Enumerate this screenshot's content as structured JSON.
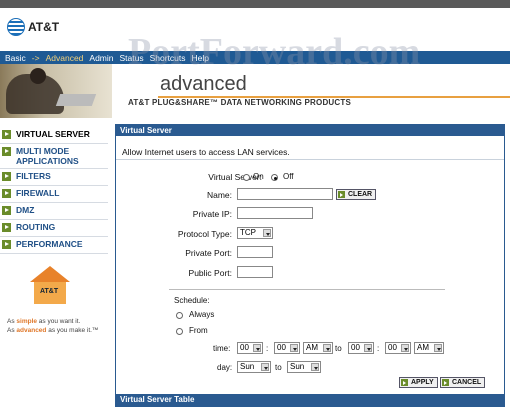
{
  "header": {
    "logo_text": "AT&T",
    "watermark": "PortForward.com"
  },
  "nav": {
    "items": [
      {
        "label": "Basic"
      },
      {
        "label": "->"
      },
      {
        "label": "Advanced"
      },
      {
        "label": "Admin"
      },
      {
        "label": "Status"
      },
      {
        "label": "Shortcuts"
      },
      {
        "label": "Help"
      }
    ]
  },
  "banner": {
    "title": "advanced",
    "tagline": "AT&T PLUG&SHARE™ DATA NETWORKING PRODUCTS"
  },
  "sidebar": {
    "items": [
      {
        "label": "VIRTUAL SERVER"
      },
      {
        "label": "MULTI MODE APPLICATIONS"
      },
      {
        "label": "FILTERS"
      },
      {
        "label": "FIREWALL"
      },
      {
        "label": "DMZ"
      },
      {
        "label": "ROUTING"
      },
      {
        "label": "PERFORMANCE"
      }
    ],
    "promo_logo": "AT&T",
    "promo_line1_pre": "As ",
    "promo_line1_bold": "simple",
    "promo_line1_post": " as you want it.",
    "promo_line2_pre": "As ",
    "promo_line2_bold": "advanced",
    "promo_line2_post": " as you make it.™"
  },
  "main": {
    "section_title": "Virtual Server",
    "description": "Allow Internet users to access LAN services.",
    "virtual_server_label": "Virtual Server:",
    "on_label": "On",
    "off_label": "Off",
    "name_label": "Name:",
    "clear_label": "CLEAR",
    "private_ip_label": "Private IP:",
    "protocol_label": "Protocol Type:",
    "protocol_value": "TCP",
    "private_port_label": "Private Port:",
    "public_port_label": "Public Port:",
    "schedule_label": "Schedule:",
    "always_label": "Always",
    "from_label": "From",
    "time_label": "time:",
    "time_h1": "00",
    "time_m1": "00",
    "time_ap1": "AM",
    "to1_label": "to",
    "time_h2": "00",
    "time_m2": "00",
    "time_ap2": "AM",
    "colon1": ":",
    "colon2": ":",
    "day_label": "day:",
    "day_from": "Sun",
    "to2_label": "to",
    "day_to": "Sun",
    "apply_label": "APPLY",
    "cancel_label": "CANCEL",
    "table_title": "Virtual Server Table"
  }
}
